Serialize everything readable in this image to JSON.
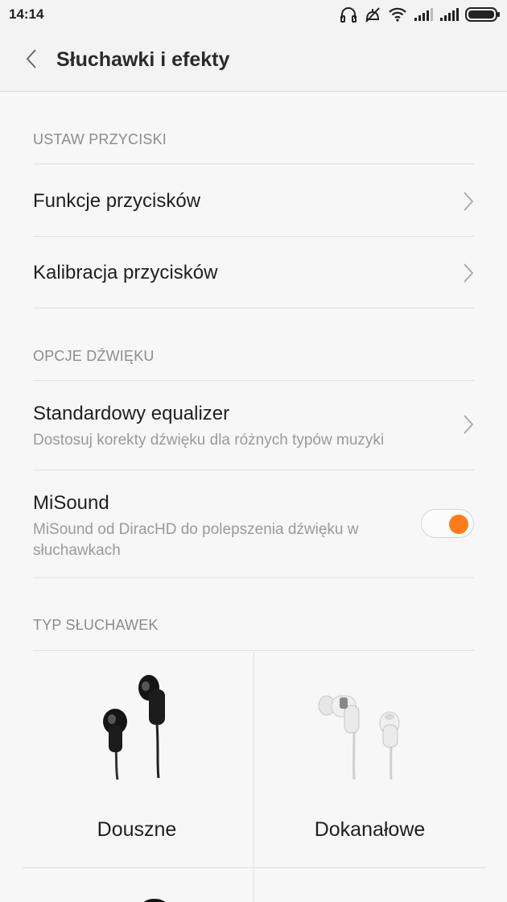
{
  "status_bar": {
    "time": "14:14",
    "icons": [
      "headphones-icon",
      "vibrate-off-icon",
      "wifi-icon",
      "signal-icon",
      "signal-icon",
      "battery-icon"
    ]
  },
  "header": {
    "title": "Słuchawki i efekty",
    "back_icon": "chevron-left-icon"
  },
  "sections": {
    "buttons": {
      "label": "USTAW PRZYCISKI",
      "items": [
        {
          "title": "Funkcje przycisków"
        },
        {
          "title": "Kalibracja przycisków"
        }
      ]
    },
    "sound": {
      "label": "OPCJE DŹWIĘKU",
      "equalizer": {
        "title": "Standardowy equalizer",
        "subtitle": "Dostosuj korekty dźwięku dla różnych typów muzyki"
      },
      "misound": {
        "title": "MiSound",
        "subtitle_line1": "MiSound od DiracHD do polepszenia dźwięku w",
        "subtitle_line2": "słuchawkach",
        "enabled": true
      }
    },
    "headphone_type": {
      "label": "TYP SŁUCHAWEK",
      "options": [
        {
          "label": "Douszne",
          "icon": "black-earbuds-icon"
        },
        {
          "label": "Dokanałowe",
          "icon": "white-in-ear-icon"
        }
      ]
    }
  },
  "colors": {
    "accent": "#ff7a18",
    "background": "#f7f7f7",
    "section_label": "#8c8c8c"
  }
}
